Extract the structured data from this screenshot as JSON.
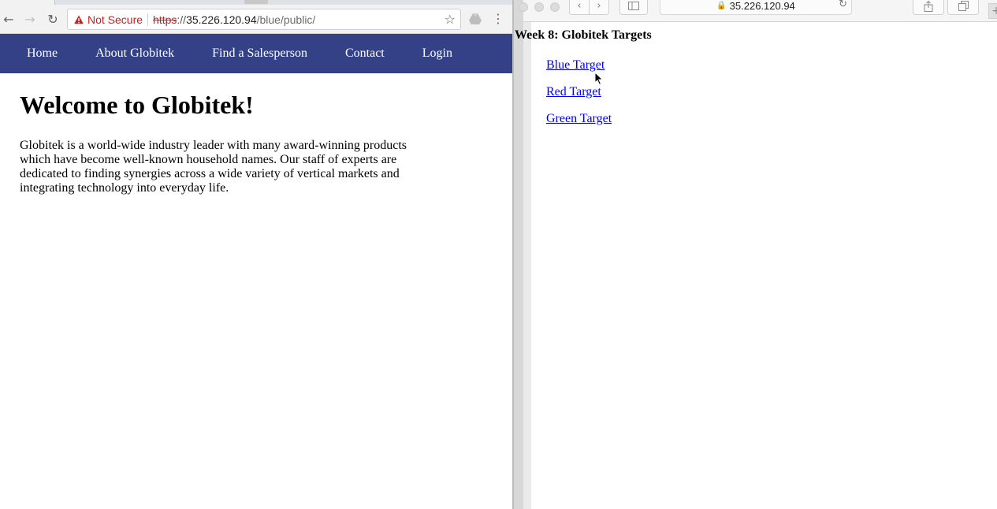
{
  "chrome": {
    "security_label": "Not Secure",
    "url_scheme": "https",
    "url_separator": "://",
    "url_host": "35.226.120.94",
    "url_path": "/blue/public/",
    "icons": {
      "back": "back-arrow-icon",
      "forward": "forward-arrow-icon",
      "reload": "reload-icon",
      "warning": "warning-triangle-icon",
      "bookmark": "star-icon",
      "extension": "drive-icon",
      "menu": "kebab-menu-icon"
    },
    "colors": {
      "warning": "#c5221f",
      "toolbar": "#f2f2f2"
    }
  },
  "site": {
    "nav": {
      "items": [
        {
          "label": "Home"
        },
        {
          "label": "About Globitek"
        },
        {
          "label": "Find a Salesperson"
        },
        {
          "label": "Contact"
        },
        {
          "label": "Login"
        }
      ],
      "background": "#344187"
    },
    "title": "Welcome to Globitek!",
    "body": "Globitek is a world-wide industry leader with many award-winning products which have become well-known household names. Our staff of experts are dedicated to finding synergies across a wide variety of vertical markets and integrating technology into everyday life."
  },
  "safari": {
    "address": "35.226.120.94",
    "icons": {
      "back": "back-chevron-icon",
      "forward": "forward-chevron-icon",
      "sidebar": "sidebar-icon",
      "lock": "lock-icon",
      "reload": "reload-icon",
      "share": "share-icon",
      "tabs": "tabs-overview-icon",
      "new_tab": "plus-icon"
    },
    "page": {
      "title": "Week 8: Globitek Targets",
      "links": [
        {
          "label": "Blue Target"
        },
        {
          "label": "Red Target"
        },
        {
          "label": "Green Target"
        }
      ],
      "link_color": "#0000ee"
    }
  },
  "cursor": {
    "icon": "arrow-cursor-icon"
  }
}
